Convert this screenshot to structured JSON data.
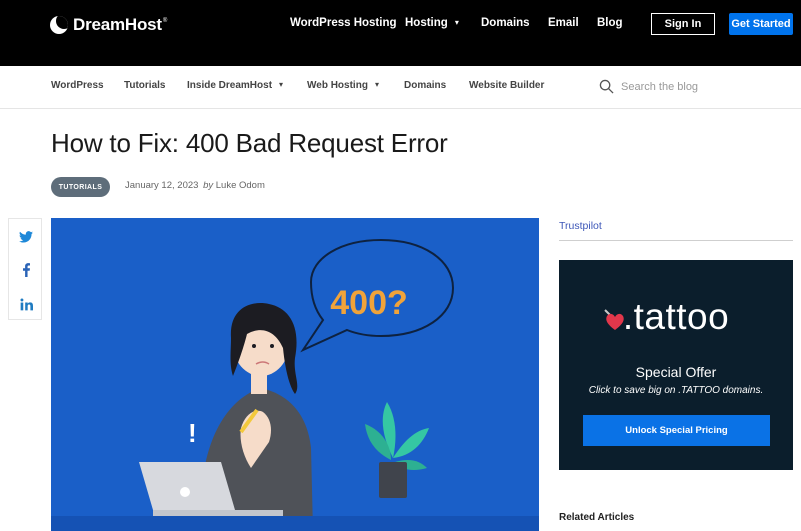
{
  "topbar": {
    "logo_text": "DreamHost",
    "logo_tm": "®",
    "nav": [
      "WordPress Hosting",
      "Hosting",
      "Domains",
      "Email",
      "Blog"
    ],
    "signin_label": "Sign In",
    "get_started_label": "Get Started",
    "colors": {
      "background": "#000000",
      "accent": "#0073ec"
    }
  },
  "subnav": {
    "items": [
      "WordPress",
      "Tutorials",
      "Inside DreamHost",
      "Web Hosting",
      "Domains",
      "Website Builder"
    ],
    "search_placeholder": "Search the blog"
  },
  "article": {
    "title": "How to Fix: 400 Bad Request Error",
    "category_badge": "TUTORIALS",
    "date": "January 12, 2023",
    "by_label": "by",
    "author": "Luke Odom",
    "hero_bubble_text": "400?",
    "hero_exclaim": "!",
    "hero_bg": "#1a5fc8"
  },
  "share": {
    "icons": [
      "twitter-icon",
      "facebook-icon",
      "linkedin-icon"
    ]
  },
  "sidebar": {
    "trustpilot_label": "Trustpilot",
    "ad": {
      "brand": ".tattoo",
      "offer_title": "Special Offer",
      "offer_subtitle": "Click to save big on .TATTOO domains.",
      "cta_label": "Unlock Special Pricing",
      "bg": "#0b1e2c"
    },
    "related_heading": "Related Articles"
  }
}
